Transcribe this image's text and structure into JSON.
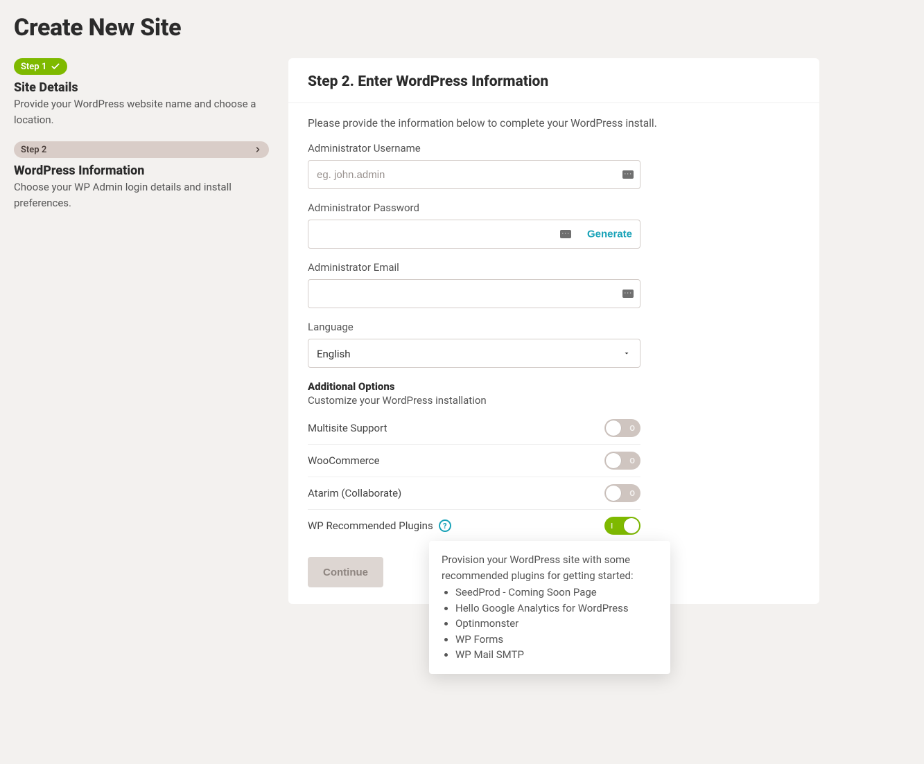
{
  "page_title": "Create New Site",
  "sidebar": {
    "step1": {
      "chip": "Step 1",
      "title": "Site Details",
      "desc": "Provide your WordPress website name and choose a location."
    },
    "step2": {
      "chip": "Step 2",
      "title": "WordPress Information",
      "desc": "Choose your WP Admin login details and install preferences."
    }
  },
  "form": {
    "heading": "Step 2. Enter WordPress Information",
    "intro": "Please provide the information below to complete your WordPress install.",
    "username": {
      "label": "Administrator Username",
      "placeholder": "eg. john.admin",
      "value": ""
    },
    "password": {
      "label": "Administrator Password",
      "value": "",
      "generate_label": "Generate"
    },
    "email": {
      "label": "Administrator Email",
      "value": ""
    },
    "language": {
      "label": "Language",
      "selected": "English"
    },
    "additional": {
      "title": "Additional Options",
      "subtitle": "Customize your WordPress installation",
      "options": [
        {
          "label": "Multisite Support",
          "on": false,
          "state": "O"
        },
        {
          "label": "WooCommerce",
          "on": false,
          "state": "O"
        },
        {
          "label": "Atarim (Collaborate)",
          "on": false,
          "state": "O"
        },
        {
          "label": "WP Recommended Plugins",
          "on": true,
          "state": "I",
          "help": true
        }
      ]
    },
    "continue_label": "Continue"
  },
  "tooltip": {
    "text": "Provision your WordPress site with some recommended plugins for getting started:",
    "items": [
      "SeedProd - Coming Soon Page",
      "Hello Google Analytics for WordPress",
      "Optinmonster",
      "WP Forms",
      "WP Mail SMTP"
    ]
  }
}
